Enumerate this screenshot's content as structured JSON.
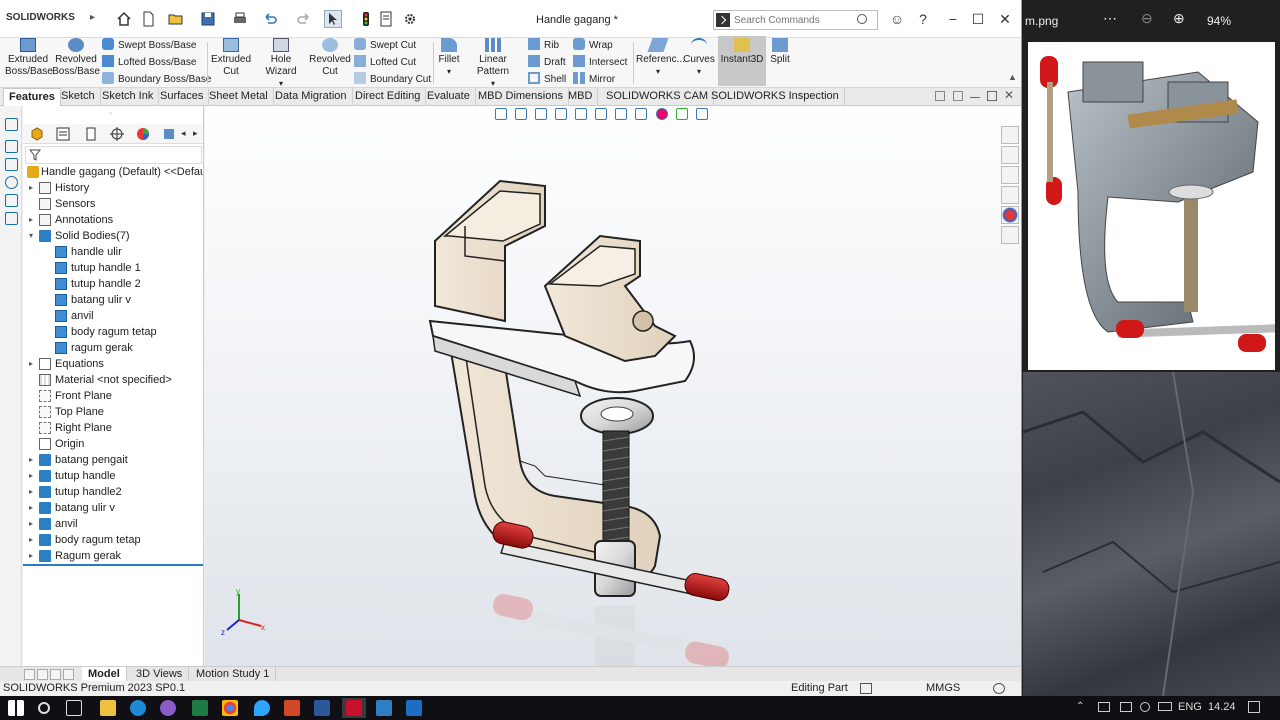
{
  "app": {
    "logo_text": "SOLIDWORKS",
    "document_title": "Handle gagang *",
    "search_placeholder": "Search Commands"
  },
  "ribbon": {
    "big_buttons": [
      {
        "label1": "Extruded",
        "label2": "Boss/Base"
      },
      {
        "label1": "Revolved",
        "label2": "Boss/Base"
      },
      {
        "label1": "Extruded",
        "label2": "Cut"
      },
      {
        "label1": "Hole Wizard",
        "label2": ""
      },
      {
        "label1": "Revolved",
        "label2": "Cut"
      },
      {
        "label1": "Fillet",
        "label2": ""
      },
      {
        "label1": "Linear Pattern",
        "label2": ""
      },
      {
        "label1": "Referenc...",
        "label2": ""
      },
      {
        "label1": "Curves",
        "label2": ""
      },
      {
        "label1": "Instant3D",
        "label2": ""
      },
      {
        "label1": "Split",
        "label2": ""
      }
    ],
    "boss_group": [
      "Swept Boss/Base",
      "Lofted Boss/Base",
      "Boundary Boss/Base"
    ],
    "cut_group": [
      "Swept Cut",
      "Lofted Cut",
      "Boundary Cut"
    ],
    "rib_group": [
      "Rib",
      "Draft",
      "Shell"
    ],
    "wrap_group": [
      "Wrap",
      "Intersect",
      "Mirror"
    ]
  },
  "tabs": [
    "Features",
    "Sketch",
    "Sketch Ink",
    "Surfaces",
    "Sheet Metal",
    "Data Migration",
    "Direct Editing",
    "Evaluate",
    "MBD Dimensions",
    "MBD",
    "SOLIDWORKS CAM",
    "SOLIDWORKS Inspection"
  ],
  "tree": {
    "root": "Handle gagang  (Default) <<Default:",
    "items": [
      {
        "label": "History",
        "icon": "history-icon",
        "indent": 0,
        "expander": "▸"
      },
      {
        "label": "Sensors",
        "icon": "sensor-icon",
        "indent": 0,
        "expander": ""
      },
      {
        "label": "Annotations",
        "icon": "annotation-icon",
        "indent": 0,
        "expander": "▸"
      },
      {
        "label": "Solid Bodies(7)",
        "icon": "solid-bodies-icon",
        "indent": 0,
        "expander": "▾"
      },
      {
        "label": "handle ulir",
        "icon": "body-icon",
        "indent": 1,
        "expander": ""
      },
      {
        "label": "tutup handle 1",
        "icon": "body-icon",
        "indent": 1,
        "expander": ""
      },
      {
        "label": "tutup handle 2",
        "icon": "body-icon",
        "indent": 1,
        "expander": ""
      },
      {
        "label": "batang ulir v",
        "icon": "body-icon",
        "indent": 1,
        "expander": ""
      },
      {
        "label": "anvil",
        "icon": "body-icon",
        "indent": 1,
        "expander": ""
      },
      {
        "label": "body ragum tetap",
        "icon": "body-icon",
        "indent": 1,
        "expander": ""
      },
      {
        "label": "ragum gerak",
        "icon": "body-icon",
        "indent": 1,
        "expander": ""
      },
      {
        "label": "Equations",
        "icon": "equation-icon",
        "indent": 0,
        "expander": "▸"
      },
      {
        "label": "Material <not specified>",
        "icon": "material-icon",
        "indent": 0,
        "expander": ""
      },
      {
        "label": "Front Plane",
        "icon": "plane-icon",
        "indent": 0,
        "expander": ""
      },
      {
        "label": "Top Plane",
        "icon": "plane-icon",
        "indent": 0,
        "expander": ""
      },
      {
        "label": "Right Plane",
        "icon": "plane-icon",
        "indent": 0,
        "expander": ""
      },
      {
        "label": "Origin",
        "icon": "origin-icon",
        "indent": 0,
        "expander": ""
      },
      {
        "label": "batang pengait",
        "icon": "folder-icon",
        "indent": 0,
        "expander": "▸"
      },
      {
        "label": "tutup handle",
        "icon": "folder-icon",
        "indent": 0,
        "expander": "▸"
      },
      {
        "label": "tutup handle2",
        "icon": "folder-icon",
        "indent": 0,
        "expander": "▸"
      },
      {
        "label": "batang ulir v",
        "icon": "folder-icon",
        "indent": 0,
        "expander": "▸"
      },
      {
        "label": "anvil",
        "icon": "folder-icon",
        "indent": 0,
        "expander": "▸"
      },
      {
        "label": "body ragum tetap",
        "icon": "folder-icon",
        "indent": 0,
        "expander": "▸"
      },
      {
        "label": "Ragum gerak",
        "icon": "folder-icon",
        "indent": 0,
        "expander": "▸"
      }
    ]
  },
  "bottom_tabs": [
    "Model",
    "3D Views",
    "Motion Study 1"
  ],
  "status": {
    "left": "SOLIDWORKS Premium 2023 SP0.1",
    "mode": "Editing Part",
    "units": "MMGS"
  },
  "viewer": {
    "filename": "m.png",
    "zoom": "94%"
  },
  "taskbar": {
    "language": "ENG",
    "time": "14.24"
  },
  "colors": {
    "accent": "#2b79c2",
    "brand": "#c8102e",
    "handle_cap": "#c8102e"
  }
}
